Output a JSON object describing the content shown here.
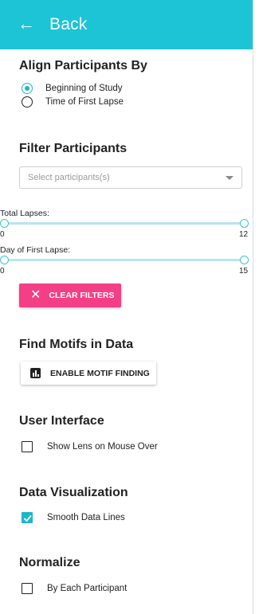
{
  "header": {
    "back_label": "Back",
    "back_icon": "arrow-left-icon"
  },
  "align": {
    "title": "Align Participants By",
    "options": [
      {
        "label": "Beginning of Study",
        "selected": true
      },
      {
        "label": "Time of First Lapse",
        "selected": false
      }
    ]
  },
  "filter": {
    "title": "Filter Participants",
    "select_placeholder": "Select participants(s)",
    "sliders": [
      {
        "label": "Total Lapses:",
        "min": "0",
        "max": "12",
        "range": [
          0,
          12
        ]
      },
      {
        "label": "Day of First Lapse:",
        "min": "0",
        "max": "15",
        "range": [
          0,
          15
        ]
      }
    ],
    "clear_label": "CLEAR FILTERS"
  },
  "motifs": {
    "title": "Find Motifs in Data",
    "button_label": "ENABLE MOTIF FINDING"
  },
  "ui": {
    "title": "User Interface",
    "show_lens_label": "Show Lens on Mouse Over",
    "show_lens_checked": false
  },
  "dataviz": {
    "title": "Data Visualization",
    "smooth_label": "Smooth Data Lines",
    "smooth_checked": true
  },
  "normalize": {
    "title": "Normalize",
    "by_participant_label": "By Each Participant",
    "by_participant_checked": false
  },
  "colors": {
    "header": "#1cc4d6",
    "accent": "#1cb6c9",
    "clear_button": "#f43f86"
  }
}
